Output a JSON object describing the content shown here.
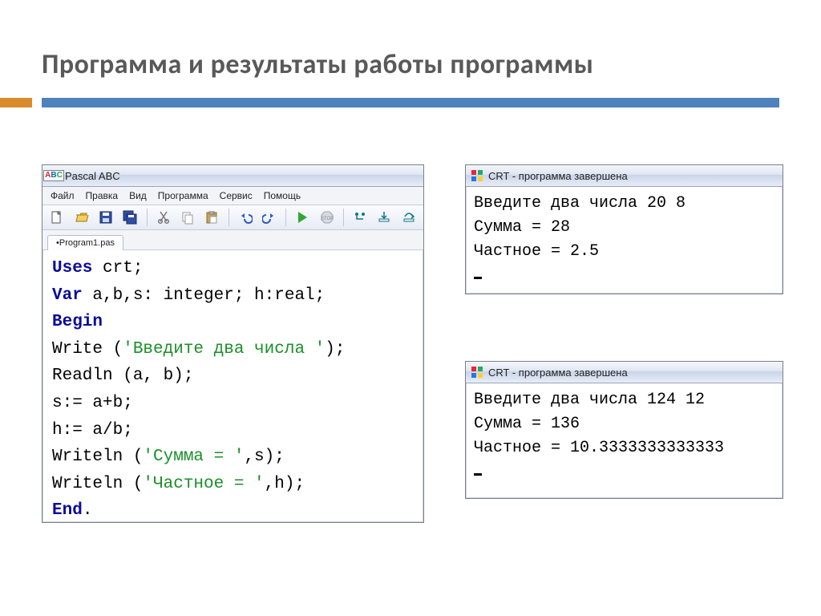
{
  "slide": {
    "title": "Программа и результаты работы программы"
  },
  "editor": {
    "title": "Pascal ABC",
    "menu": [
      "Файл",
      "Правка",
      "Вид",
      "Программа",
      "Сервис",
      "Помощь"
    ],
    "tab": "•Program1.pas",
    "code": {
      "uses_kw": "Uses",
      "uses_rest": " crt;",
      "var_kw": "Var",
      "var_rest": " a,b,s: integer; h:real;",
      "begin_kw": "Begin",
      "l4a": "Write (",
      "l4s": "'Введите два числа '",
      "l4b": ");",
      "l5": "Readln (a, b);",
      "l6": "s:= a+b;",
      "l7": "h:= a/b;",
      "l8a": "Writeln (",
      "l8s": "'Сумма = '",
      "l8b": ",s);",
      "l9a": "Writeln (",
      "l9s": "'Частное = '",
      "l9b": ",h);",
      "end_kw": "End",
      "end_dot": "."
    }
  },
  "out1": {
    "title": "CRT - программа завершена",
    "lines": [
      "Введите два числа 20 8",
      "Сумма = 28",
      "Частное = 2.5"
    ]
  },
  "out2": {
    "title": "CRT - программа завершена",
    "lines": [
      "Введите два числа 124 12",
      "Сумма = 136",
      "Частное = 10.3333333333333"
    ]
  }
}
